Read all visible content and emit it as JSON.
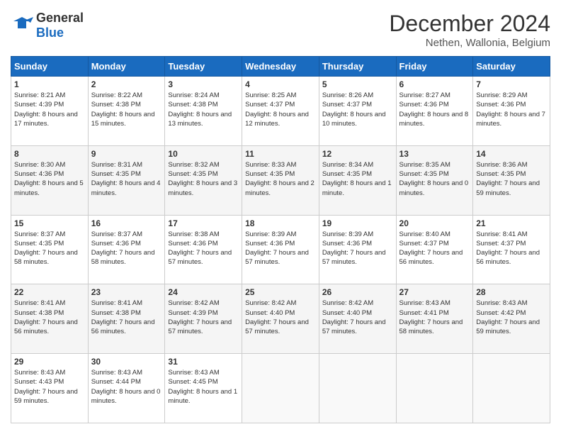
{
  "header": {
    "logo_general": "General",
    "logo_blue": "Blue",
    "month_title": "December 2024",
    "subtitle": "Nethen, Wallonia, Belgium"
  },
  "days": [
    "Sunday",
    "Monday",
    "Tuesday",
    "Wednesday",
    "Thursday",
    "Friday",
    "Saturday"
  ],
  "weeks": [
    [
      {
        "day": "1",
        "sunrise": "8:21 AM",
        "sunset": "4:39 PM",
        "daylight": "8 hours and 17 minutes."
      },
      {
        "day": "2",
        "sunrise": "8:22 AM",
        "sunset": "4:38 PM",
        "daylight": "8 hours and 15 minutes."
      },
      {
        "day": "3",
        "sunrise": "8:24 AM",
        "sunset": "4:38 PM",
        "daylight": "8 hours and 13 minutes."
      },
      {
        "day": "4",
        "sunrise": "8:25 AM",
        "sunset": "4:37 PM",
        "daylight": "8 hours and 12 minutes."
      },
      {
        "day": "5",
        "sunrise": "8:26 AM",
        "sunset": "4:37 PM",
        "daylight": "8 hours and 10 minutes."
      },
      {
        "day": "6",
        "sunrise": "8:27 AM",
        "sunset": "4:36 PM",
        "daylight": "8 hours and 8 minutes."
      },
      {
        "day": "7",
        "sunrise": "8:29 AM",
        "sunset": "4:36 PM",
        "daylight": "8 hours and 7 minutes."
      }
    ],
    [
      {
        "day": "8",
        "sunrise": "8:30 AM",
        "sunset": "4:36 PM",
        "daylight": "8 hours and 5 minutes."
      },
      {
        "day": "9",
        "sunrise": "8:31 AM",
        "sunset": "4:35 PM",
        "daylight": "8 hours and 4 minutes."
      },
      {
        "day": "10",
        "sunrise": "8:32 AM",
        "sunset": "4:35 PM",
        "daylight": "8 hours and 3 minutes."
      },
      {
        "day": "11",
        "sunrise": "8:33 AM",
        "sunset": "4:35 PM",
        "daylight": "8 hours and 2 minutes."
      },
      {
        "day": "12",
        "sunrise": "8:34 AM",
        "sunset": "4:35 PM",
        "daylight": "8 hours and 1 minute."
      },
      {
        "day": "13",
        "sunrise": "8:35 AM",
        "sunset": "4:35 PM",
        "daylight": "8 hours and 0 minutes."
      },
      {
        "day": "14",
        "sunrise": "8:36 AM",
        "sunset": "4:35 PM",
        "daylight": "7 hours and 59 minutes."
      }
    ],
    [
      {
        "day": "15",
        "sunrise": "8:37 AM",
        "sunset": "4:35 PM",
        "daylight": "7 hours and 58 minutes."
      },
      {
        "day": "16",
        "sunrise": "8:37 AM",
        "sunset": "4:36 PM",
        "daylight": "7 hours and 58 minutes."
      },
      {
        "day": "17",
        "sunrise": "8:38 AM",
        "sunset": "4:36 PM",
        "daylight": "7 hours and 57 minutes."
      },
      {
        "day": "18",
        "sunrise": "8:39 AM",
        "sunset": "4:36 PM",
        "daylight": "7 hours and 57 minutes."
      },
      {
        "day": "19",
        "sunrise": "8:39 AM",
        "sunset": "4:36 PM",
        "daylight": "7 hours and 57 minutes."
      },
      {
        "day": "20",
        "sunrise": "8:40 AM",
        "sunset": "4:37 PM",
        "daylight": "7 hours and 56 minutes."
      },
      {
        "day": "21",
        "sunrise": "8:41 AM",
        "sunset": "4:37 PM",
        "daylight": "7 hours and 56 minutes."
      }
    ],
    [
      {
        "day": "22",
        "sunrise": "8:41 AM",
        "sunset": "4:38 PM",
        "daylight": "7 hours and 56 minutes."
      },
      {
        "day": "23",
        "sunrise": "8:41 AM",
        "sunset": "4:38 PM",
        "daylight": "7 hours and 56 minutes."
      },
      {
        "day": "24",
        "sunrise": "8:42 AM",
        "sunset": "4:39 PM",
        "daylight": "7 hours and 57 minutes."
      },
      {
        "day": "25",
        "sunrise": "8:42 AM",
        "sunset": "4:40 PM",
        "daylight": "7 hours and 57 minutes."
      },
      {
        "day": "26",
        "sunrise": "8:42 AM",
        "sunset": "4:40 PM",
        "daylight": "7 hours and 57 minutes."
      },
      {
        "day": "27",
        "sunrise": "8:43 AM",
        "sunset": "4:41 PM",
        "daylight": "7 hours and 58 minutes."
      },
      {
        "day": "28",
        "sunrise": "8:43 AM",
        "sunset": "4:42 PM",
        "daylight": "7 hours and 59 minutes."
      }
    ],
    [
      {
        "day": "29",
        "sunrise": "8:43 AM",
        "sunset": "4:43 PM",
        "daylight": "7 hours and 59 minutes."
      },
      {
        "day": "30",
        "sunrise": "8:43 AM",
        "sunset": "4:44 PM",
        "daylight": "8 hours and 0 minutes."
      },
      {
        "day": "31",
        "sunrise": "8:43 AM",
        "sunset": "4:45 PM",
        "daylight": "8 hours and 1 minute."
      },
      null,
      null,
      null,
      null
    ]
  ]
}
